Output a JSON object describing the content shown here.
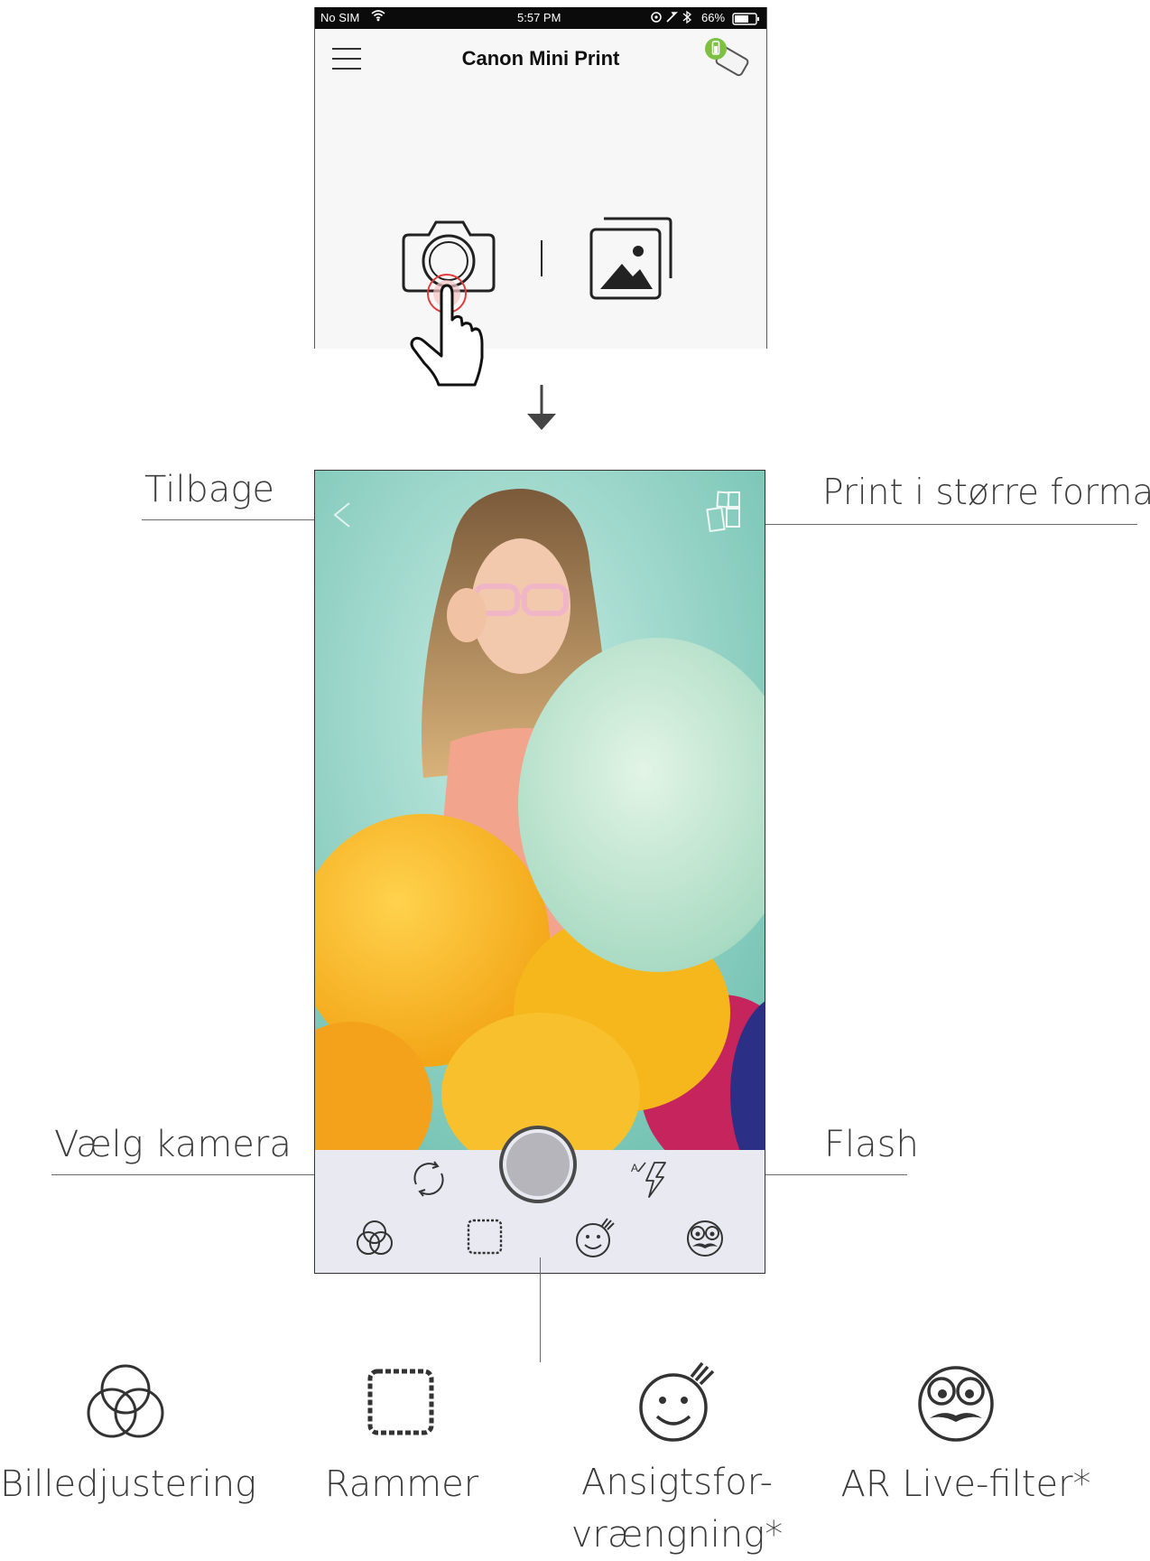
{
  "status_bar": {
    "carrier": "No SIM",
    "time": "5:57 PM",
    "battery": "66%"
  },
  "app": {
    "title": "Canon Mini Print"
  },
  "callouts": {
    "back": "Tilbage",
    "print_larger": "Print i større format",
    "choose_camera": "Vælg kamera",
    "flash": "Flash"
  },
  "features": [
    {
      "label": "Billedjustering",
      "icon": "color-adjust-icon"
    },
    {
      "label": "Rammer",
      "icon": "frame-icon"
    },
    {
      "label": "Ansigtsfor-\nvrængning*",
      "icon": "face-warp-icon"
    },
    {
      "label": "AR Live-filter*",
      "icon": "ar-filter-icon"
    }
  ],
  "colors": {
    "mint": "#8fd0c0",
    "toolbar": "#e9e9f1",
    "printer_green": "#7dc143",
    "tap_red": "#e23b3b"
  }
}
